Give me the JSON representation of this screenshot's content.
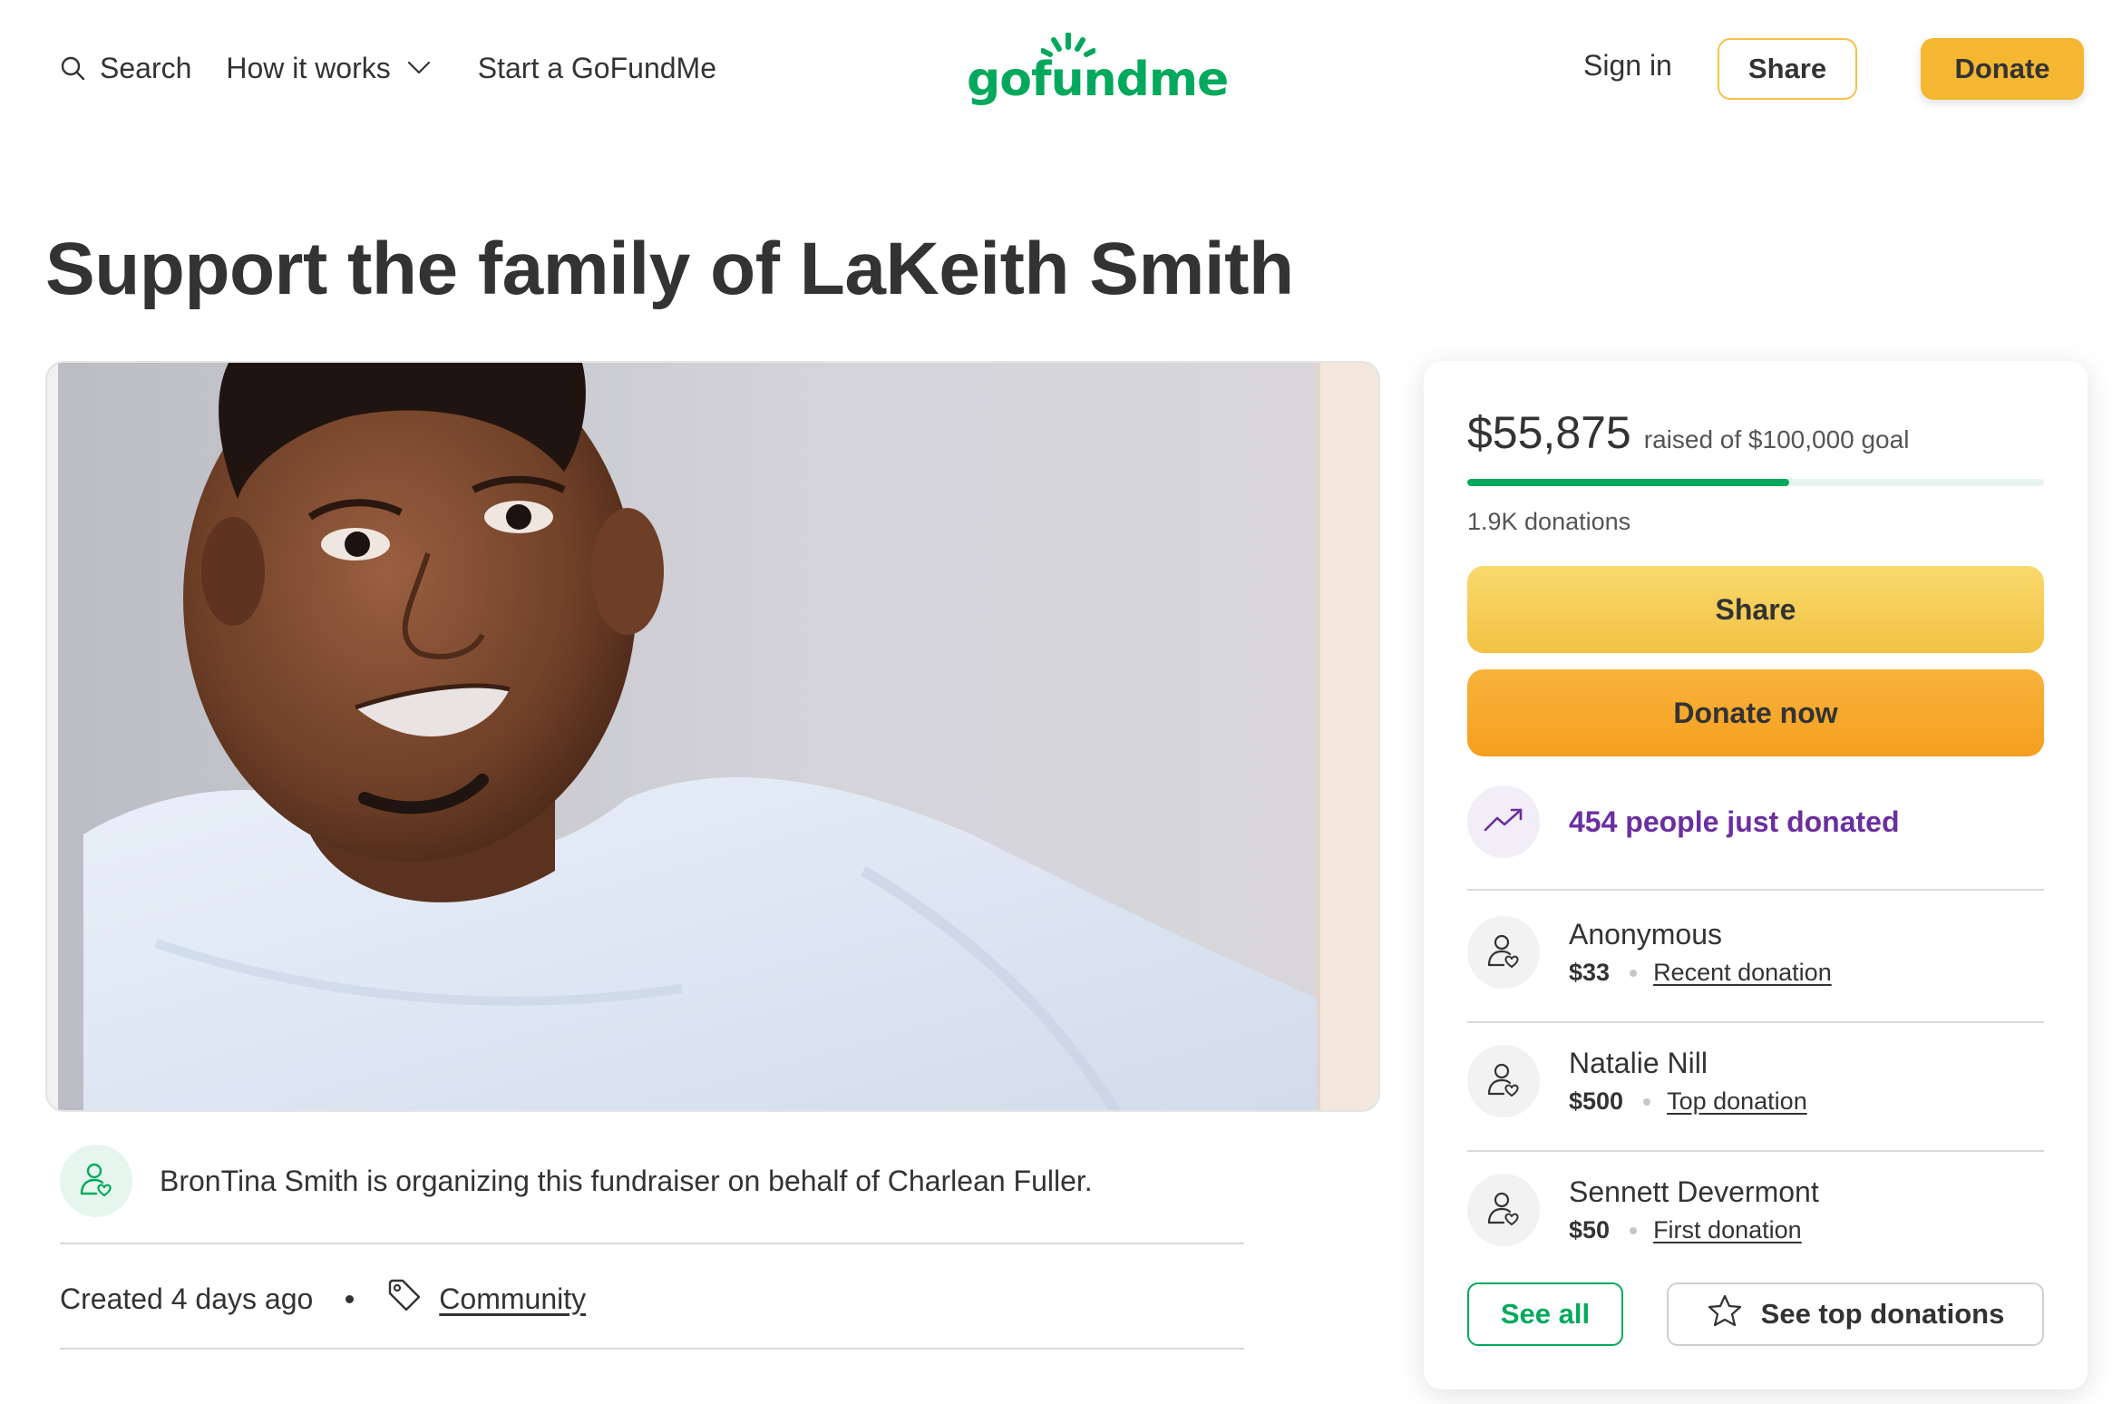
{
  "header": {
    "search_label": "Search",
    "how_it_works_label": "How it works",
    "start_label": "Start a GoFundMe",
    "logo_text": "gofundme",
    "sign_in_label": "Sign in",
    "share_label": "Share",
    "donate_label": "Donate"
  },
  "campaign": {
    "title": "Support the family of LaKeith Smith",
    "organizer_text": "BronTina Smith is organizing this fundraiser on behalf of Charlean Fuller.",
    "created_text": "Created 4 days ago",
    "category": "Community"
  },
  "sidebar": {
    "raised_amount": "$55,875",
    "goal_text": "raised of $100,000 goal",
    "progress_fraction": 0.5588,
    "donations_count": "1.9K donations",
    "share_button": "Share",
    "donate_button": "Donate now",
    "trend_text": "454 people just donated",
    "donors": [
      {
        "name": "Anonymous",
        "amount": "$33",
        "type": "Recent donation"
      },
      {
        "name": "Natalie Nill",
        "amount": "$500",
        "type": "Top donation"
      },
      {
        "name": "Sennett Devermont",
        "amount": "$50",
        "type": "First donation"
      }
    ],
    "see_all_button": "See all",
    "see_top_button": "See top donations"
  },
  "colors": {
    "brand_green": "#02a95c",
    "donate_orange": "#f5b731",
    "trend_purple": "#6b2fa0"
  },
  "icons": {
    "search": "search-icon",
    "dropdown": "chevron-down-icon",
    "organizer": "person-heart-icon",
    "category": "tag-icon",
    "trend": "trending-up-icon",
    "donor": "person-heart-icon",
    "star": "star-icon"
  }
}
